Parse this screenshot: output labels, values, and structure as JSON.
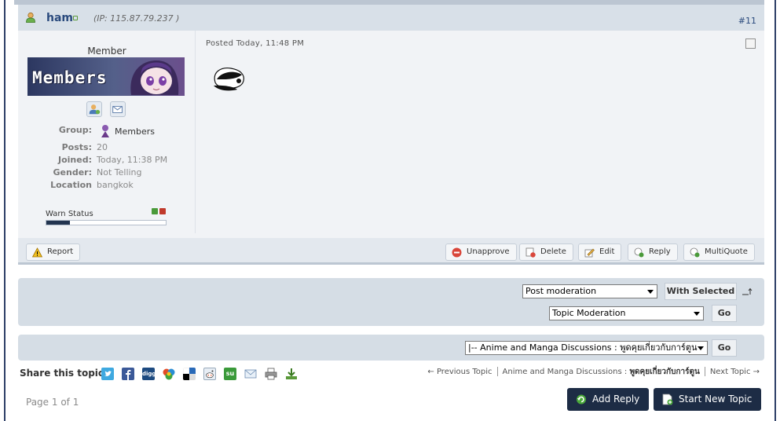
{
  "post": {
    "username": "ham",
    "ip": "(IP: 115.87.79.237 )",
    "number": "#11",
    "posted": "Posted Today, 11:48 PM"
  },
  "author": {
    "rank": "Member",
    "banner_text": "Members",
    "fields": [
      {
        "label": "Group:",
        "value": "Members"
      },
      {
        "label": "Posts:",
        "value": "20"
      },
      {
        "label": "Joined:",
        "value": "Today, 11:38 PM"
      },
      {
        "label": "Gender:",
        "value": "Not Telling"
      },
      {
        "label": "Location",
        "value": "bangkok"
      }
    ],
    "warn_label": "Warn Status",
    "warn_level": 0.2
  },
  "post_buttons": {
    "report": "Report",
    "unapprove": "Unapprove",
    "delete": "Delete",
    "edit": "Edit",
    "reply": "Reply",
    "multiquote": "MultiQuote"
  },
  "moderation": {
    "post_select": "Post moderation",
    "with_selected": "With Selected",
    "topic_select": "Topic Moderation",
    "go": "Go"
  },
  "jump": {
    "forum_select": "|-- Anime and Manga Discussions : พูดคุยเกี่ยวกับการ์ตูน",
    "go": "Go"
  },
  "share": {
    "label": "Share this topic:",
    "icons": [
      "twitter-icon",
      "facebook-icon",
      "digg-icon",
      "google-buzz-icon",
      "delicious-icon",
      "reddit-icon",
      "stumbleupon-icon",
      "email-icon",
      "print-icon",
      "download-icon"
    ],
    "digg_text": "digg",
    "su_text": "su"
  },
  "topic_nav": {
    "prev": "← Previous Topic",
    "forum_prefix": "Anime and Manga Discussions :",
    "forum_thai": "พูดคุยเกี่ยวกับการ์ตูน",
    "next": "Next Topic →"
  },
  "footer": {
    "page": "Page 1 of 1",
    "add_reply": "Add Reply",
    "new_topic": "Start New Topic"
  },
  "colors": {
    "header_bg": "#d8e0e8",
    "body_bg": "#f1f3f6",
    "dark_button": "#1d2c45",
    "link": "#2a4a7d"
  }
}
